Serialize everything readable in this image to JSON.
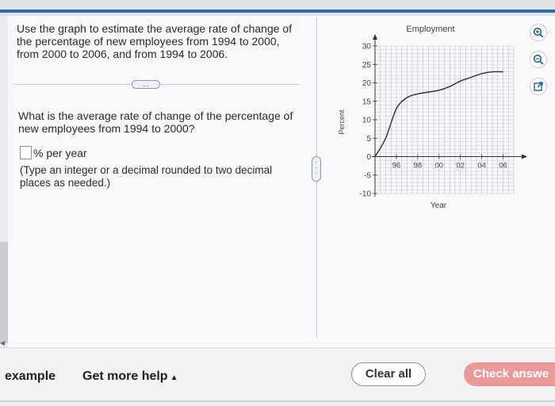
{
  "question": {
    "prompt": "Use the graph to estimate the average rate of change of the percentage of new employees from 1994 to 2000, from 2000 to 2006, and from 1994 to 2006.",
    "more_label": "...",
    "subquestion": "What is the average rate of change of the percentage of new employees from 1994 to 2000?",
    "answer_value": "",
    "answer_unit": "% per year",
    "hint": "(Type an integer or a decimal rounded to two decimal places as needed.)",
    "handle_label": "..."
  },
  "chart_data": {
    "type": "line",
    "title": "Employment",
    "xlabel": "Year",
    "ylabel": "Percent",
    "x_tick_labels": [
      "96",
      "98",
      "00",
      "02",
      "04",
      "06"
    ],
    "y_tick_labels": [
      "30",
      "25",
      "20",
      "15",
      "10",
      "5",
      "0",
      "-5",
      "-10"
    ],
    "ylim": [
      -10,
      30
    ],
    "xlim": [
      1994,
      2007
    ],
    "grid": true,
    "x": [
      1994,
      1995,
      1996,
      1997,
      1998,
      1999,
      2000,
      2001,
      2002,
      2003,
      2004,
      2005,
      2006
    ],
    "y": [
      0,
      5,
      13,
      16,
      17,
      17.5,
      18,
      19,
      20.5,
      21.5,
      22.5,
      23,
      23
    ],
    "line_color": "#2b2b2b"
  },
  "icons": {
    "zoom_in": "zoom-in-icon",
    "zoom_out": "zoom-out-icon",
    "popout": "popout-icon"
  },
  "footer": {
    "example_label": "example",
    "help_label": "Get more help",
    "help_caret": "▲",
    "clear_label": "Clear all",
    "check_label": "Check answe"
  },
  "colors": {
    "check_button": "#ea9a9a",
    "accent_icon": "#1f5f99"
  }
}
